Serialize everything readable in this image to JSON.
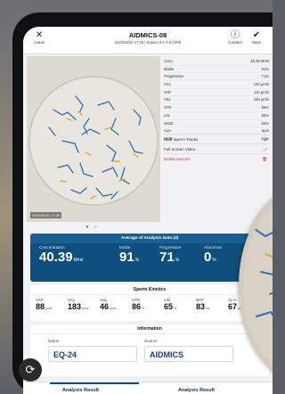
{
  "topbar": {
    "leave_label": "Leave",
    "title": "AIDMICS-08",
    "subtitle": "2022/05/24 17:26  |  Equine 6.2 S (LOP9)",
    "contact_label": "Contact",
    "save_label": "Save"
  },
  "micrograph": {
    "timestamp": "2022/05/24 17:26"
  },
  "params": [
    {
      "label": "Conc.",
      "value": "40.39 M/ml"
    },
    {
      "label": "Motile",
      "value": "91%"
    },
    {
      "label": "Progressive",
      "value": "71%"
    },
    {
      "label": "VCL",
      "value": "120 μm/s"
    },
    {
      "label": "VAP",
      "value": "112 μm/s"
    },
    {
      "label": "VSL",
      "value": "108 μm/s"
    },
    {
      "label": "STR",
      "value": "86%"
    },
    {
      "label": "LIN",
      "value": "65%"
    },
    {
      "label": "WOB",
      "value": "83%"
    },
    {
      "label": "ALH",
      "value": "6μm"
    },
    {
      "label": "MOB",
      "value": "51%"
    }
  ],
  "options": {
    "hide_tracks": "Hide Sperm Tracks",
    "full_screen": "Full Screen Video",
    "delete": "Delete Record"
  },
  "average": {
    "header": "Average of Analysis Data (4)",
    "concentration": {
      "label": "Concentration",
      "value": "40.39",
      "unit": "M/ml"
    },
    "motile": {
      "label": "Motile",
      "value": "91",
      "unit": "%"
    },
    "progressive": {
      "label": "Progressive",
      "value": "71",
      "unit": "%"
    },
    "abnormal": {
      "label": "Abnormal",
      "value": "0",
      "unit": "%"
    }
  },
  "kinetics": {
    "header": "Sperm Kinetics",
    "items": [
      {
        "label": "VAP",
        "value": "88",
        "unit": "μm/s"
      },
      {
        "label": "VCL",
        "value": "183",
        "unit": "μm/s"
      },
      {
        "label": "VSL",
        "value": "46",
        "unit": "μm/s"
      },
      {
        "label": "STR",
        "value": "86",
        "unit": "%"
      },
      {
        "label": "LIN",
        "value": "65",
        "unit": "%"
      },
      {
        "label": "BCF",
        "value": "83",
        "unit": "Hz"
      },
      {
        "label": "ALH",
        "value": "67",
        "unit": "μm"
      }
    ]
  },
  "information": {
    "header": "Information",
    "name_label": "Name",
    "name_value": "EQ-24",
    "source_label": "Source",
    "source_value": "AIDMICS"
  },
  "tabs": {
    "left": "Analysis Result",
    "right": "Analysis Result"
  },
  "colors": {
    "panel_blue": "#0f4f7e",
    "track_blue": "#2f6fae",
    "track_yellow": "#e0a92b",
    "delete_red": "#c0392b"
  }
}
